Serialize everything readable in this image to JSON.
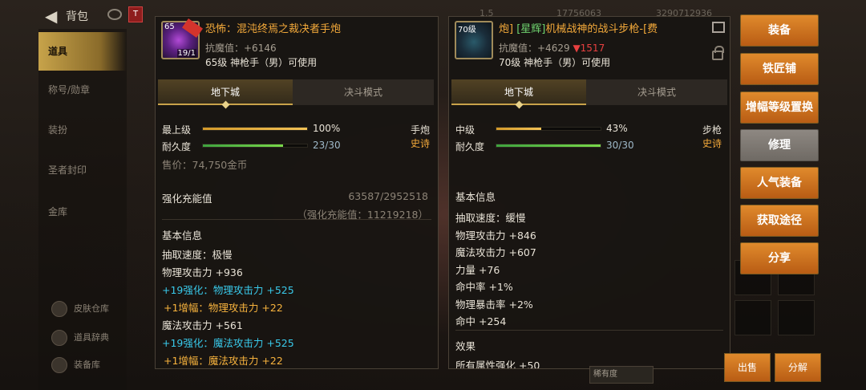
{
  "header": {
    "title": "背包",
    "badge": "T",
    "currency_1": "1.5",
    "currency_2": "17756063",
    "currency_3": "3290712936"
  },
  "sidebar": {
    "items": [
      {
        "label": "道具",
        "active": true
      },
      {
        "label": "称号/勋章"
      },
      {
        "label": "装扮"
      },
      {
        "label": "圣者封印"
      },
      {
        "label": "金库"
      }
    ],
    "bottom": [
      {
        "label": "皮肤仓库"
      },
      {
        "label": "道具辞典"
      },
      {
        "label": "装备库"
      }
    ]
  },
  "item1": {
    "icon_level": "65",
    "icon_enhance": "19/1",
    "name": "恐怖：混沌终焉之裁决者手炮",
    "resist": "抗魔值：+6146",
    "requirement": "65级 神枪手（男）可使用",
    "tabs": [
      "地下城",
      "决斗模式"
    ],
    "grade_label": "最上级",
    "grade_pct": 100,
    "grade_text": "100%",
    "durability_label": "耐久度",
    "durability_pct": 76.7,
    "durability_text": "23/30",
    "weapon_type": "手炮",
    "rarity": "史诗",
    "price": "售价：74,750金币",
    "reinforce_label": "强化充能值",
    "reinforce_value": "63587/2952518",
    "reinforce_sub": "（强化充能值：11219218）",
    "basic_info_title": "基本信息",
    "stats": [
      {
        "text": "抽取速度：极慢",
        "color": "normal"
      },
      {
        "text": "物理攻击力 +936",
        "color": "normal"
      },
      {
        "text": "+19强化：物理攻击力 +525",
        "color": "cyan"
      },
      {
        "text": "+1增幅：物理攻击力 +22",
        "color": "orange"
      },
      {
        "text": "魔法攻击力 +561",
        "color": "normal"
      },
      {
        "text": "+19强化：魔法攻击力 +525",
        "color": "cyan"
      },
      {
        "text": "+1增幅：魔法攻击力 +22",
        "color": "orange"
      }
    ]
  },
  "item2": {
    "icon_level": "70级",
    "name_prefix": "炮]",
    "name_set": "[星辉]",
    "name_main": "机械战神的战斗步枪-[费",
    "resist_base": "抗魔值：+4629",
    "resist_diff": "▼1517",
    "requirement": "70级 神枪手（男）可使用",
    "tabs": [
      "地下城",
      "决斗模式"
    ],
    "grade_label": "中级",
    "grade_pct": 43,
    "grade_text": "43%",
    "durability_label": "耐久度",
    "durability_pct": 100,
    "durability_text": "30/30",
    "weapon_type": "步枪",
    "rarity": "史诗",
    "basic_info_title": "基本信息",
    "stats": [
      "抽取速度：缓慢",
      "物理攻击力 +846",
      "魔法攻击力 +607",
      "力量 +76",
      "命中率 +1%",
      "物理暴击率 +2%",
      "命中 +254"
    ],
    "effect_title": "效果",
    "effect_partial": "所有属性强化 +50"
  },
  "menu": [
    {
      "label": "装备",
      "style": "orange"
    },
    {
      "label": "铁匠铺",
      "style": "orange"
    },
    {
      "label": "增幅等级置换",
      "style": "orange"
    },
    {
      "label": "修理",
      "style": "gray"
    },
    {
      "label": "人气装备",
      "style": "orange"
    },
    {
      "label": "获取途径",
      "style": "orange"
    },
    {
      "label": "分享",
      "style": "orange"
    }
  ],
  "bottom": {
    "sell": "出售",
    "split": "分解",
    "dropdown": "稀有度"
  }
}
